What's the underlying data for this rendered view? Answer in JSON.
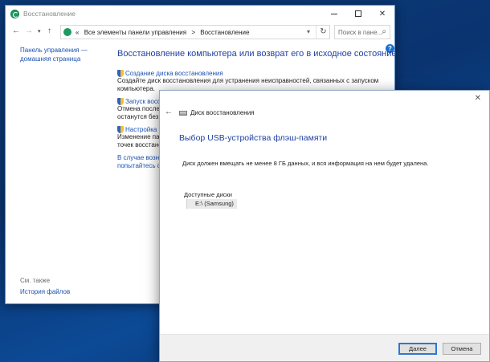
{
  "background_window": {
    "title": "Восстановление",
    "address": {
      "crumbs": [
        "«",
        "Все элементы панели управления",
        ">",
        "Восстановление"
      ],
      "search_placeholder": "Поиск в пане..."
    },
    "left_pane": {
      "home_link": "Панель управления — домашняя страница",
      "see_also_label": "См. также",
      "history_link": "История файлов"
    },
    "main": {
      "heading": "Восстановление компьютера или возврат его в исходное состояние",
      "tasks": [
        {
          "link": "Создание диска восстановления",
          "desc": "Создайте диск восстановления для устранения неисправностей, связанных с запуском компьютера."
        },
        {
          "link": "Запуск восстановления системы",
          "desc": "Отмена последних изменений системы, но файлы документов, изображения и музыка останутся без изменений."
        },
        {
          "link": "Настройка восстановления системы",
          "desc": "Изменение параметров восстановления, управление дисковым пространством и удаление точек восстановления."
        }
      ],
      "recover_link": "В случае возникновения проблем с компьютером перейдите в «Параметры» и попытайтесь сбросить его."
    }
  },
  "dialog": {
    "title": "Диск восстановления",
    "heading": "Выбор USB-устройства флэш-памяти",
    "message": "Диск должен вмещать не менее 8 ГБ данных, и вся информация на нем будет удалена.",
    "drives_label": "Доступные диски",
    "drives": [
      "E:\\ (Samsung)"
    ],
    "next_button": "Далее",
    "cancel_button": "Отмена"
  },
  "colors": {
    "link": "#1a52b3",
    "heading": "#1e3fa0",
    "accent_border": "#2a78d6",
    "desktop": "#0b3a78"
  }
}
